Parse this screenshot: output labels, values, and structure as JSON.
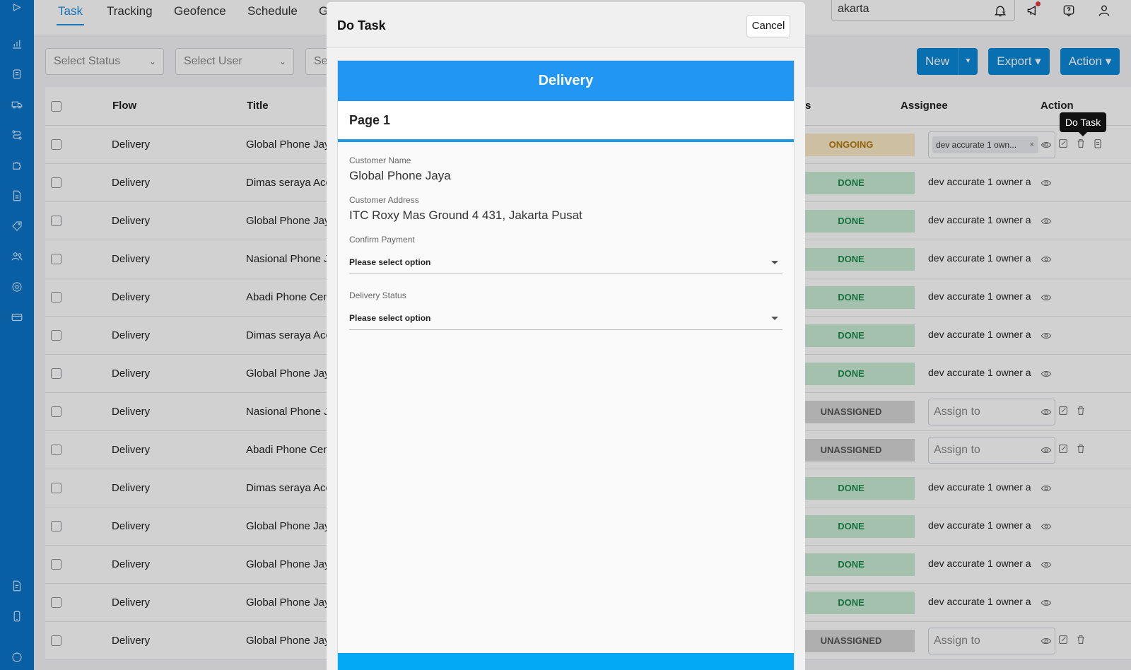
{
  "nav": {
    "tabs": [
      {
        "label": "Task"
      },
      {
        "label": "Tracking"
      },
      {
        "label": "Geofence"
      },
      {
        "label": "Schedule"
      },
      {
        "label": "G"
      }
    ],
    "location": "akarta"
  },
  "filters": {
    "status": "Select Status",
    "user": "Select User",
    "third": "Se"
  },
  "buttons": {
    "new": "New",
    "export": "Export",
    "action": "Action"
  },
  "table": {
    "headers": {
      "flow": "Flow",
      "title": "Title",
      "status": "s",
      "assignee": "Assignee",
      "action": "Action"
    },
    "rows": [
      {
        "flow": "Delivery",
        "title": "Global Phone Jaya",
        "status": "ONGOING",
        "status_type": "ongoing",
        "assignee": "dev accurate 1 own...",
        "assignee_mode": "chip"
      },
      {
        "flow": "Delivery",
        "title": "Dimas seraya Acc",
        "status": "DONE",
        "status_type": "done",
        "assignee": "dev accurate 1 owner a",
        "assignee_mode": "text"
      },
      {
        "flow": "Delivery",
        "title": "Global Phone Jaya",
        "status": "DONE",
        "status_type": "done",
        "assignee": "dev accurate 1 owner a",
        "assignee_mode": "text"
      },
      {
        "flow": "Delivery",
        "title": "Nasional Phone Ja",
        "status": "DONE",
        "status_type": "done",
        "assignee": "dev accurate 1 owner a",
        "assignee_mode": "text"
      },
      {
        "flow": "Delivery",
        "title": "Abadi Phone Cent",
        "status": "DONE",
        "status_type": "done",
        "assignee": "dev accurate 1 owner a",
        "assignee_mode": "text"
      },
      {
        "flow": "Delivery",
        "title": "Dimas seraya Acc",
        "status": "DONE",
        "status_type": "done",
        "assignee": "dev accurate 1 owner a",
        "assignee_mode": "text"
      },
      {
        "flow": "Delivery",
        "title": "Global Phone Jaya",
        "status": "DONE",
        "status_type": "done",
        "assignee": "dev accurate 1 owner a",
        "assignee_mode": "text"
      },
      {
        "flow": "Delivery",
        "title": "Nasional Phone Ja",
        "status": "UNASSIGNED",
        "status_type": "unassigned",
        "assignee": "Assign to",
        "assignee_mode": "select"
      },
      {
        "flow": "Delivery",
        "title": "Abadi Phone Cent",
        "status": "UNASSIGNED",
        "status_type": "unassigned",
        "assignee": "Assign to",
        "assignee_mode": "select"
      },
      {
        "flow": "Delivery",
        "title": "Dimas seraya Acc",
        "status": "DONE",
        "status_type": "done",
        "assignee": "dev accurate 1 owner a",
        "assignee_mode": "text"
      },
      {
        "flow": "Delivery",
        "title": "Global Phone Jaya",
        "status": "DONE",
        "status_type": "done",
        "assignee": "dev accurate 1 owner a",
        "assignee_mode": "text"
      },
      {
        "flow": "Delivery",
        "title": "Global Phone Jaya",
        "status": "DONE",
        "status_type": "done",
        "assignee": "dev accurate 1 owner a",
        "assignee_mode": "text"
      },
      {
        "flow": "Delivery",
        "title": "Global Phone Jaya",
        "status": "DONE",
        "status_type": "done",
        "assignee": "dev accurate 1 owner a",
        "assignee_mode": "text"
      },
      {
        "flow": "Delivery",
        "title": "Global Phone Jaya",
        "status": "UNASSIGNED",
        "status_type": "unassigned",
        "assignee": "Assign to",
        "assignee_mode": "select"
      }
    ]
  },
  "tooltip": "Do Task",
  "modal": {
    "title": "Do Task",
    "cancel": "Cancel",
    "form_title": "Delivery",
    "page": "Page 1",
    "customer_name_label": "Customer Name",
    "customer_name": "Global Phone Jaya",
    "customer_address_label": "Customer Address",
    "customer_address": "ITC Roxy Mas Ground 4 431, Jakarta Pusat",
    "confirm_payment_label": "Confirm Payment",
    "confirm_payment_value": "Please select option",
    "delivery_status_label": "Delivery Status",
    "delivery_status_value": "Please select option"
  },
  "colors": {
    "sidebar": "#0a74c9",
    "primary": "#0a88d8",
    "form_header": "#2196f3",
    "done": "#c8ecd3",
    "ongoing": "#fbe9c6",
    "unassigned": "#d6d6d6"
  }
}
